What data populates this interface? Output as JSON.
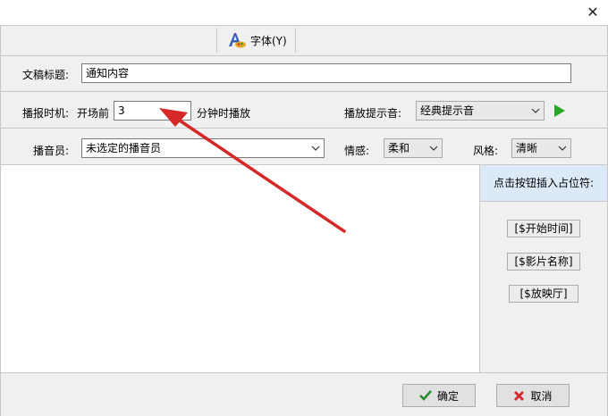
{
  "window": {
    "close_glyph": "✕"
  },
  "toolbar": {
    "font_label": "字体(Y)",
    "font_icon": "font-icon"
  },
  "fields": {
    "title_label": "文稿标题:",
    "title_value": "通知内容",
    "timing_label": "播报时机:",
    "timing_prefix": "开场前",
    "timing_value": "3",
    "timing_suffix": "分钟时播放",
    "alert_sound_label": "播放提示音:",
    "alert_sound_value": "经典提示音",
    "announcer_label": "播音员:",
    "announcer_value": "未选定的播音员",
    "emotion_label": "情感:",
    "emotion_value": "柔和",
    "style_label": "风格:",
    "style_value": "清晰"
  },
  "placeholders": {
    "header": "点击按钮插入占位符:",
    "buttons": [
      "[$开始时间]",
      "[$影片名称]",
      "[$放映厅]"
    ]
  },
  "footer": {
    "ok_label": "确定",
    "cancel_label": "取消"
  },
  "colors": {
    "play": "#27a527",
    "annotation_arrow": "#d62828",
    "ok_check": "#2e8b2e",
    "cancel_x": "#d42a2a"
  }
}
